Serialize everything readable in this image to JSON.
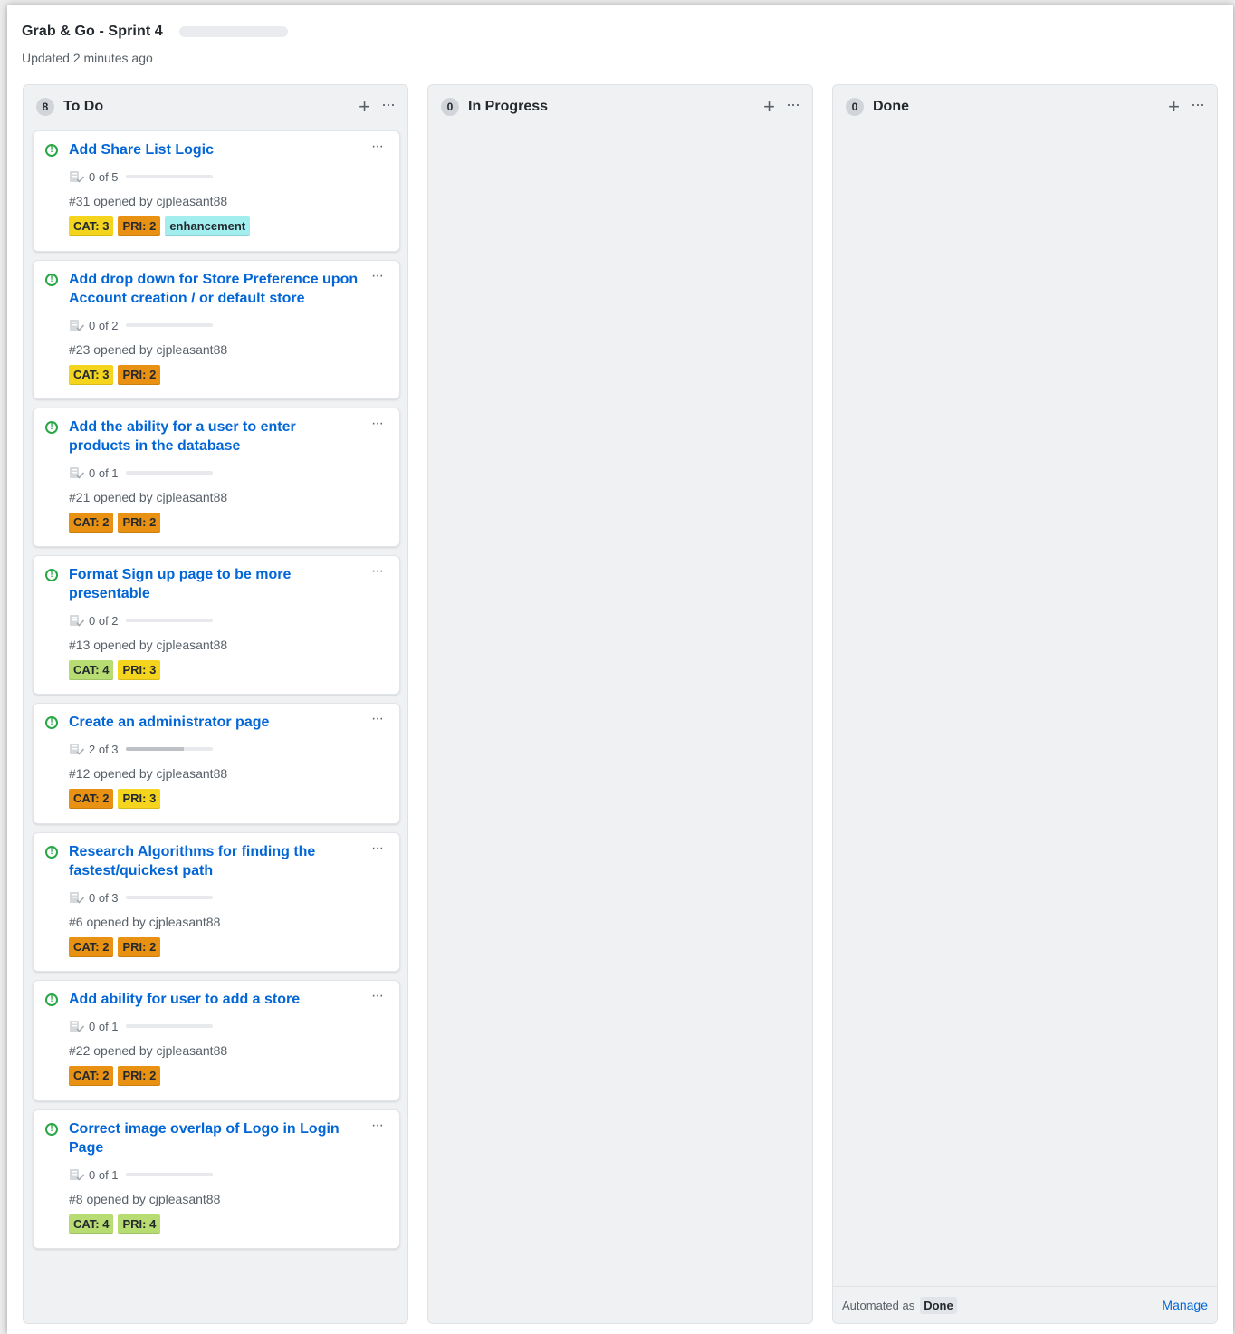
{
  "board": {
    "title": "Grab & Go - Sprint 4",
    "updated": "Updated 2 minutes ago"
  },
  "columns": [
    {
      "name": "To Do",
      "count": "8",
      "add_icon": "+",
      "more_icon": "···",
      "cards": [
        {
          "title": "Add Share List Logic",
          "tasks": "0 of 5",
          "progress": 0.0,
          "opened": "#31 opened by cjpleasant88",
          "labels": [
            {
              "text": "CAT: 3",
              "color": "#f4d41c"
            },
            {
              "text": "PRI: 2",
              "color": "#e89112"
            },
            {
              "text": "enhancement",
              "color": "#a2eeef"
            }
          ]
        },
        {
          "title": "Add drop down for Store Preference upon Account creation / or default store",
          "tasks": "0 of 2",
          "progress": 0.0,
          "opened": "#23 opened by cjpleasant88",
          "labels": [
            {
              "text": "CAT: 3",
              "color": "#f4d41c"
            },
            {
              "text": "PRI: 2",
              "color": "#e89112"
            }
          ]
        },
        {
          "title": "Add the ability for a user to enter products in the database",
          "tasks": "0 of 1",
          "progress": 0.0,
          "opened": "#21 opened by cjpleasant88",
          "labels": [
            {
              "text": "CAT: 2",
              "color": "#e89112"
            },
            {
              "text": "PRI: 2",
              "color": "#e89112"
            }
          ]
        },
        {
          "title": "Format Sign up page to be more presentable",
          "tasks": "0 of 2",
          "progress": 0.0,
          "opened": "#13 opened by cjpleasant88",
          "labels": [
            {
              "text": "CAT: 4",
              "color": "#b7dc72"
            },
            {
              "text": "PRI: 3",
              "color": "#f4d41c"
            }
          ]
        },
        {
          "title": "Create an administrator page",
          "tasks": "2 of 3",
          "progress": 0.67,
          "opened": "#12 opened by cjpleasant88",
          "labels": [
            {
              "text": "CAT: 2",
              "color": "#e89112"
            },
            {
              "text": "PRI: 3",
              "color": "#f4d41c"
            }
          ]
        },
        {
          "title": "Research Algorithms for finding the fastest/quickest path",
          "tasks": "0 of 3",
          "progress": 0.0,
          "opened": "#6 opened by cjpleasant88",
          "labels": [
            {
              "text": "CAT: 2",
              "color": "#e89112"
            },
            {
              "text": "PRI: 2",
              "color": "#e89112"
            }
          ]
        },
        {
          "title": "Add ability for user to add a store",
          "tasks": "0 of 1",
          "progress": 0.0,
          "opened": "#22 opened by cjpleasant88",
          "labels": [
            {
              "text": "CAT: 2",
              "color": "#e89112"
            },
            {
              "text": "PRI: 2",
              "color": "#e89112"
            }
          ]
        },
        {
          "title": "Correct image overlap of Logo in Login Page",
          "tasks": "0 of 1",
          "progress": 0.0,
          "opened": "#8 opened by cjpleasant88",
          "labels": [
            {
              "text": "CAT: 4",
              "color": "#b7dc72"
            },
            {
              "text": "PRI: 4",
              "color": "#b7dc72"
            }
          ]
        }
      ]
    },
    {
      "name": "In Progress",
      "count": "0",
      "add_icon": "+",
      "more_icon": "···",
      "cards": []
    },
    {
      "name": "Done",
      "count": "0",
      "add_icon": "+",
      "more_icon": "···",
      "cards": [],
      "footer": {
        "automated_label": "Automated as",
        "automated_value": "Done",
        "manage_label": "Manage"
      }
    }
  ],
  "icons": {
    "issue": "issue-opened-icon",
    "tasks": "checklist-icon",
    "more": "kebab-horizontal-icon",
    "add": "plus-icon"
  },
  "colors": {
    "link": "#0366d6",
    "issue_open": "#28a745",
    "column_bg": "#f0f1f3"
  }
}
